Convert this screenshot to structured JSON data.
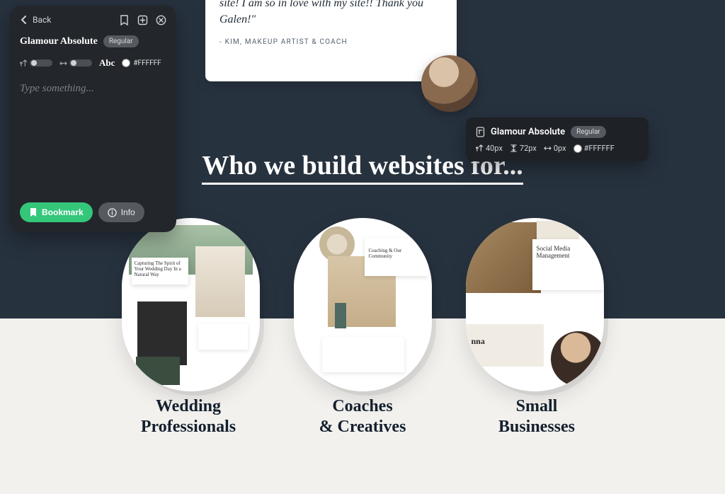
{
  "panel": {
    "back_label": "Back",
    "font_name": "Glamour Absolute",
    "weight_label": "Regular",
    "sample_label": "Abc",
    "color_hex": "#FFFFFF",
    "placeholder": "Type something...",
    "bookmark_label": "Bookmark",
    "info_label": "Info"
  },
  "tooltip": {
    "font_name": "Glamour Absolute",
    "weight_label": "Regular",
    "size": "40px",
    "line_height": "72px",
    "letter_spacing": "0px",
    "color_hex": "#FFFFFF"
  },
  "testimonial": {
    "quote": "getting all the information they need from my site! I am so in love with my site!! Thank you Galen!\"",
    "attribution": "- KIM, MAKEUP ARTIST & COACH"
  },
  "heading": "Who we build websites for...",
  "categories": [
    {
      "line1": "Wedding",
      "line2": "Professionals"
    },
    {
      "line1": "Coaches",
      "line2": "& Creatives"
    },
    {
      "line1": "Small",
      "line2": "Businesses"
    }
  ],
  "mock_text": {
    "p1_caption": "Capturing The Spirit of Your Wedding Day In a Natural Way",
    "p2_caption": "Coaching & Our Community",
    "p3_caption": "Social Media Management",
    "p3_name": "nna"
  }
}
